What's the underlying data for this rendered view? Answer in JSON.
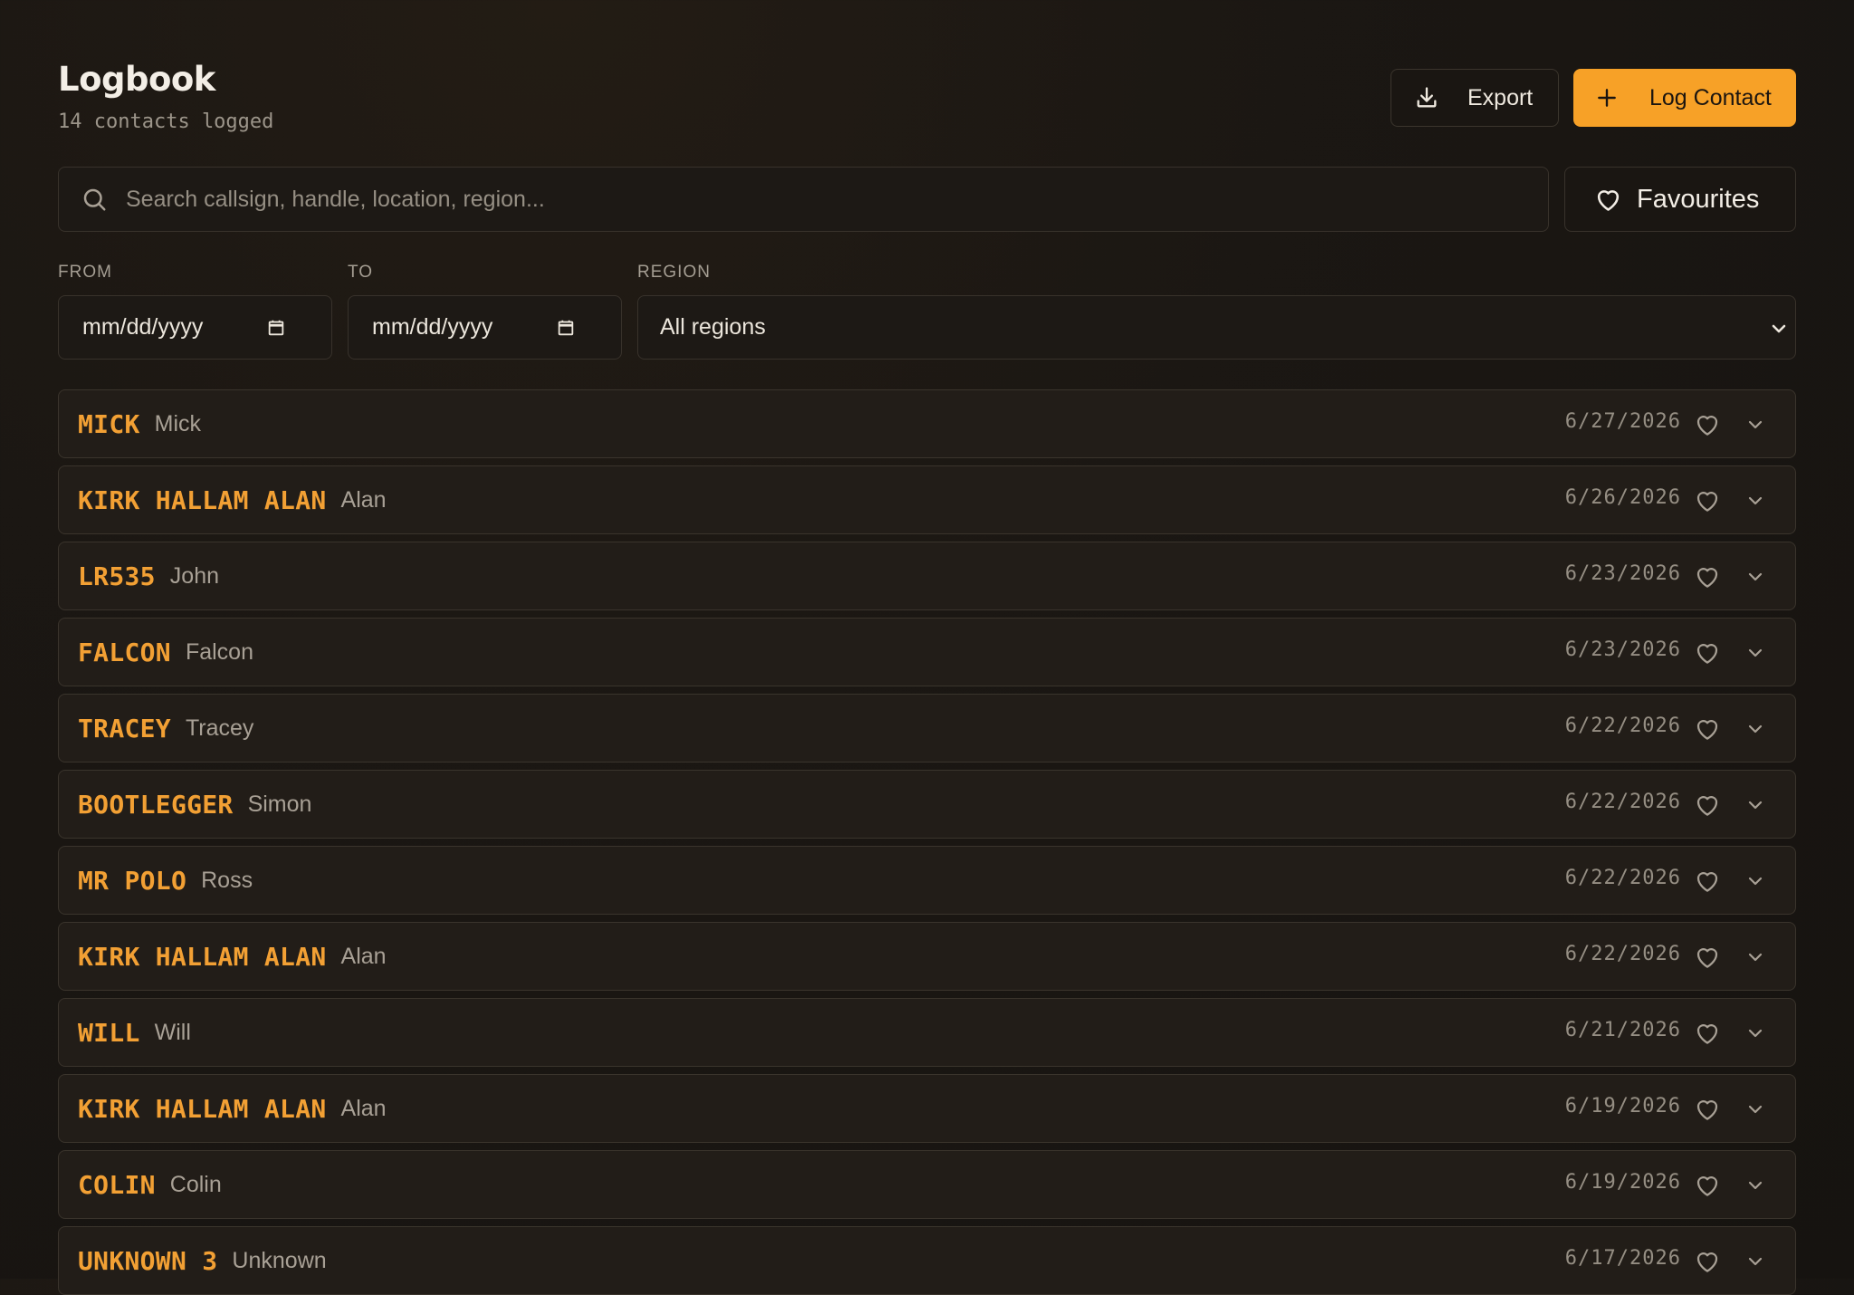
{
  "header": {
    "title": "Logbook",
    "subtitle": "14 contacts logged",
    "export_label": "Export",
    "log_label": "Log Contact"
  },
  "search": {
    "placeholder": "Search callsign, handle, location, region...",
    "favourites_label": "Favourites"
  },
  "filters": {
    "from_label": "FROM",
    "to_label": "TO",
    "region_label": "REGION",
    "from_value": "mm/dd/yyyy",
    "to_value": "mm/dd/yyyy",
    "region_value": "All regions"
  },
  "contacts": [
    {
      "callsign": "MICK",
      "handle": "Mick",
      "date": "6/27/2026"
    },
    {
      "callsign": "KIRK HALLAM ALAN",
      "handle": "Alan",
      "date": "6/26/2026"
    },
    {
      "callsign": "LR535",
      "handle": "John",
      "date": "6/23/2026"
    },
    {
      "callsign": "FALCON",
      "handle": "Falcon",
      "date": "6/23/2026"
    },
    {
      "callsign": "TRACEY",
      "handle": "Tracey",
      "date": "6/22/2026"
    },
    {
      "callsign": "BOOTLEGGER",
      "handle": "Simon",
      "date": "6/22/2026"
    },
    {
      "callsign": "MR POLO",
      "handle": "Ross",
      "date": "6/22/2026"
    },
    {
      "callsign": "KIRK HALLAM ALAN",
      "handle": "Alan",
      "date": "6/22/2026"
    },
    {
      "callsign": "WILL",
      "handle": "Will",
      "date": "6/21/2026"
    },
    {
      "callsign": "KIRK HALLAM ALAN",
      "handle": "Alan",
      "date": "6/19/2026"
    },
    {
      "callsign": "COLIN",
      "handle": "Colin",
      "date": "6/19/2026"
    },
    {
      "callsign": "UNKNOWN 3",
      "handle": "Unknown",
      "date": "6/17/2026"
    }
  ],
  "icons": {
    "export": "download-icon",
    "log": "plus-icon",
    "search": "search-icon",
    "favourites": "heart-icon",
    "calendar": "calendar-icon",
    "region_dropdown": "chevron-down-icon",
    "row_favourite": "heart-icon",
    "row_expand": "chevron-down-icon"
  },
  "colors": {
    "accent": "#f7a127",
    "callsign": "#f2a034",
    "background": "#1b1713",
    "row_background": "#221d18",
    "border": "#3a342c"
  }
}
